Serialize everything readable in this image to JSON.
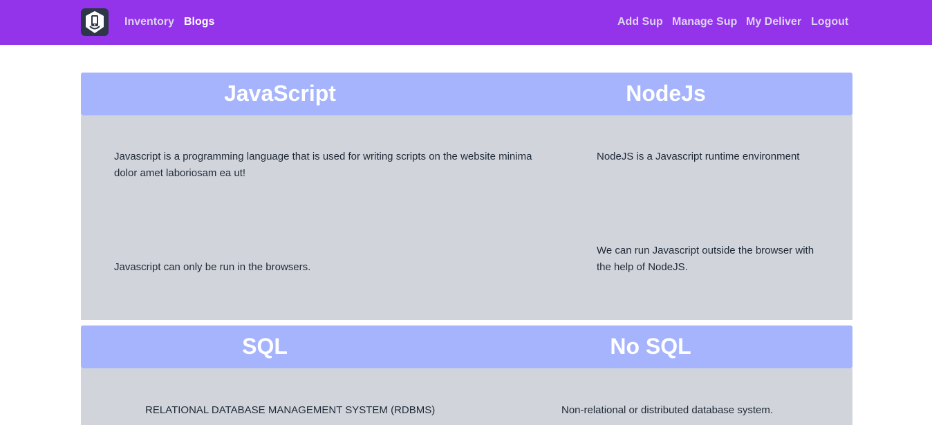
{
  "navbar": {
    "left_links": [
      "Inventory",
      "Blogs"
    ],
    "right_links": [
      "Add Sup",
      "Manage Sup",
      "My Deliver",
      "Logout"
    ],
    "active": "Blogs",
    "color": "#9333ea"
  },
  "cards": [
    {
      "left_title": "JavaScript",
      "right_title": "NodeJs",
      "left_points": [
        "Javascript is a programming language that is used for writing scripts on the website minima dolor amet laboriosam ea ut!",
        "Javascript can only be run in the browsers."
      ],
      "right_points": [
        "NodeJS is a Javascript runtime environment",
        "We can run Javascript outside the browser with the help of NodeJS."
      ]
    },
    {
      "left_title": "SQL",
      "right_title": "No SQL",
      "left_points": [
        "RELATIONAL DATABASE MANAGEMENT SYSTEM (RDBMS)"
      ],
      "right_points": [
        "Non-relational or distributed database system."
      ]
    }
  ],
  "colors": {
    "header": "#a5b4fc",
    "body": "#d1d5db"
  }
}
